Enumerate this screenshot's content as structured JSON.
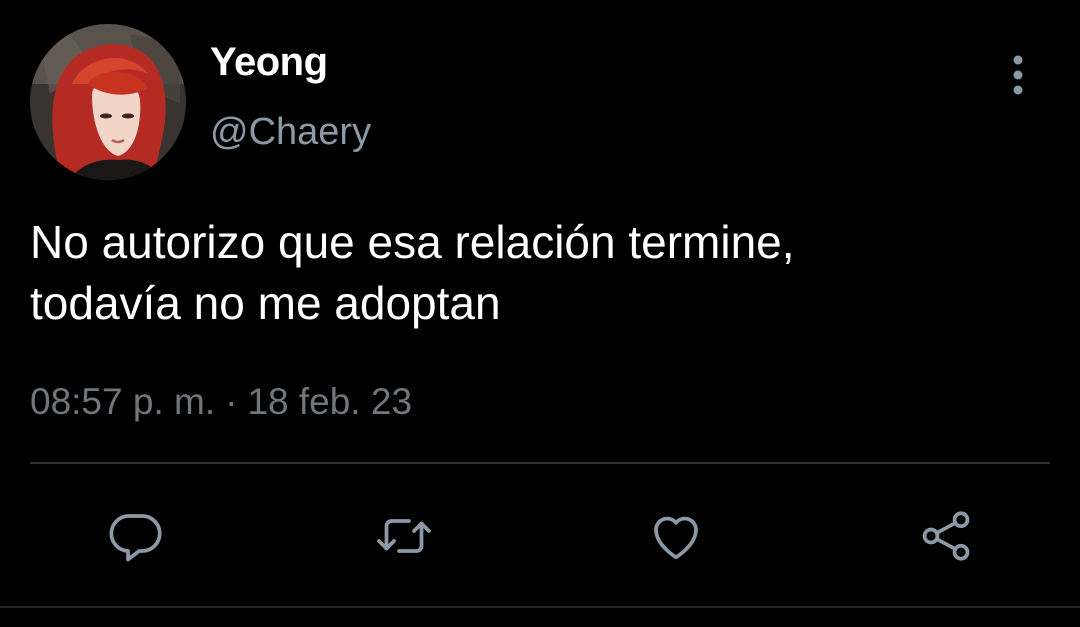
{
  "author": {
    "display_name": "Yeong",
    "handle": "@Chaery",
    "avatar_icon": "profile-photo"
  },
  "tweet": {
    "text": "No autorizo que esa relación termine,\ntodavía no me adoptan",
    "time": "08:57 p. m.",
    "separator": "·",
    "date": "18 feb. 23"
  },
  "actions": [
    {
      "icon": "reply-icon"
    },
    {
      "icon": "retweet-icon"
    },
    {
      "icon": "like-icon"
    },
    {
      "icon": "share-icon"
    }
  ],
  "colors": {
    "background": "#000000",
    "primary_text": "#ffffff",
    "secondary_text": "#71767b",
    "icon": "#8b98a5",
    "divider": "#2f3336"
  }
}
